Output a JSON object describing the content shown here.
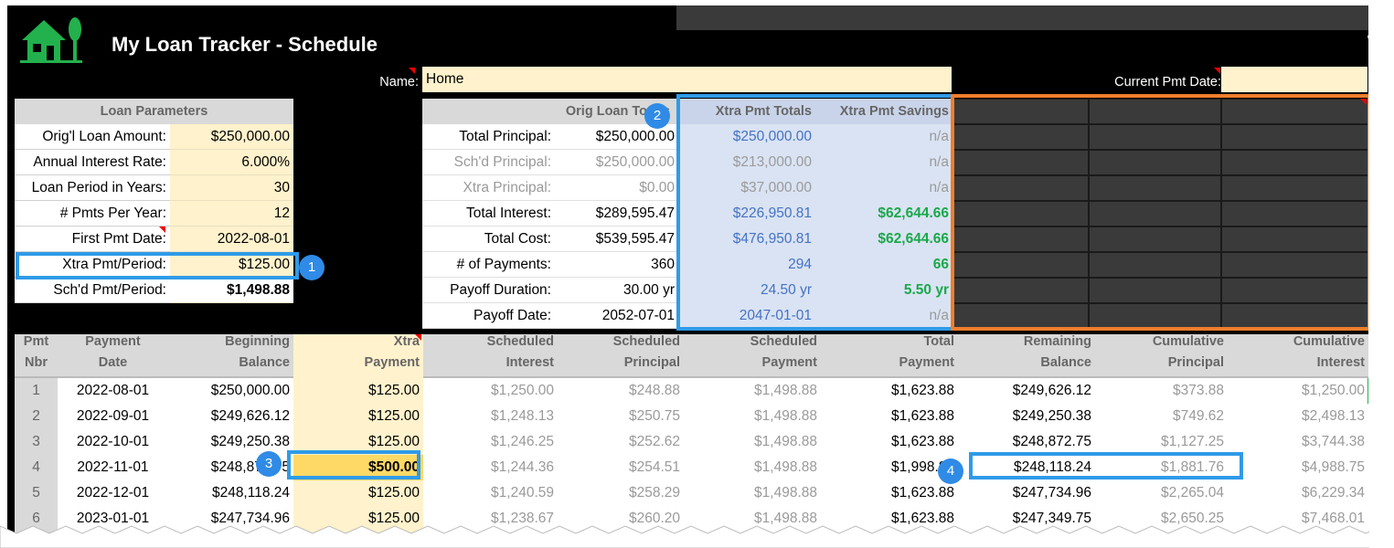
{
  "title": "My Loan Tracker - Schedule",
  "name_label": "Name:",
  "name_value": "Home",
  "current_pmt_label": "Current Pmt Date:",
  "current_pmt_value": "",
  "params": {
    "header": "Loan Parameters",
    "rows": [
      {
        "label": "Orig'l Loan Amount:",
        "value": "$250,000.00"
      },
      {
        "label": "Annual Interest Rate:",
        "value": "6.000%"
      },
      {
        "label": "Loan Period in Years:",
        "value": "30"
      },
      {
        "label": "# Pmts Per Year:",
        "value": "12"
      },
      {
        "label": "First Pmt Date:",
        "value": "2022-08-01"
      },
      {
        "label": "Xtra Pmt/Period:",
        "value": "$125.00"
      },
      {
        "label": "Sch'd Pmt/Period:",
        "value": "$1,498.88"
      }
    ]
  },
  "totals": {
    "headers": {
      "orig": "Orig Loan Totals",
      "xtra": "Xtra Pmt Totals",
      "savings": "Xtra Pmt Savings"
    },
    "rows": [
      {
        "label": "Total Principal:",
        "orig": "$250,000.00",
        "xtra": "$250,000.00",
        "savings": "n/a"
      },
      {
        "label": "Sch'd Principal:",
        "orig": "$250,000.00",
        "xtra": "$213,000.00",
        "savings": "n/a"
      },
      {
        "label": "Xtra Principal:",
        "orig": "$0.00",
        "xtra": "$37,000.00",
        "savings": "n/a"
      },
      {
        "label": "Total Interest:",
        "orig": "$289,595.47",
        "xtra": "$226,950.81",
        "savings": "$62,644.66"
      },
      {
        "label": "Total Cost:",
        "orig": "$539,595.47",
        "xtra": "$476,950.81",
        "savings": "$62,644.66"
      },
      {
        "label": "# of Payments:",
        "orig": "360",
        "xtra": "294",
        "savings": "66"
      },
      {
        "label": "Payoff Duration:",
        "orig": "30.00 yr",
        "xtra": "24.50 yr",
        "savings": "5.50 yr"
      },
      {
        "label": "Payoff Date:",
        "orig": "2052-07-01",
        "xtra": "2047-01-01",
        "savings": "n/a"
      }
    ]
  },
  "schedule": {
    "headers": [
      [
        "Pmt",
        "Nbr"
      ],
      [
        "Payment",
        "Date"
      ],
      [
        "Beginning",
        "Balance"
      ],
      [
        "Xtra",
        "Payment"
      ],
      [
        "Scheduled",
        "Interest"
      ],
      [
        "Scheduled",
        "Principal"
      ],
      [
        "Scheduled",
        "Payment"
      ],
      [
        "Total",
        "Payment"
      ],
      [
        "Remaining",
        "Balance"
      ],
      [
        "Cumulative",
        "Principal"
      ],
      [
        "Cumulative",
        "Interest"
      ]
    ],
    "rows": [
      [
        "1",
        "2022-08-01",
        "$250,000.00",
        "$125.00",
        "$1,250.00",
        "$248.88",
        "$1,498.88",
        "$1,623.88",
        "$249,626.12",
        "$373.88",
        "$1,250.00"
      ],
      [
        "2",
        "2022-09-01",
        "$249,626.12",
        "$125.00",
        "$1,248.13",
        "$250.75",
        "$1,498.88",
        "$1,623.88",
        "$249,250.38",
        "$749.62",
        "$2,498.13"
      ],
      [
        "3",
        "2022-10-01",
        "$249,250.38",
        "$125.00",
        "$1,246.25",
        "$252.62",
        "$1,498.88",
        "$1,623.88",
        "$248,872.75",
        "$1,127.25",
        "$3,744.38"
      ],
      [
        "4",
        "2022-11-01",
        "$248,872.75",
        "$500.00",
        "$1,244.36",
        "$254.51",
        "$1,498.88",
        "$1,998.88",
        "$248,118.24",
        "$1,881.76",
        "$4,988.75"
      ],
      [
        "5",
        "2022-12-01",
        "$248,118.24",
        "$125.00",
        "$1,240.59",
        "$258.29",
        "$1,498.88",
        "$1,623.88",
        "$247,734.96",
        "$2,265.04",
        "$6,229.34"
      ],
      [
        "6",
        "2023-01-01",
        "$247,734.96",
        "$125.00",
        "$1,238.67",
        "$260.20",
        "$1,498.88",
        "$1,623.88",
        "$247,349.75",
        "$2,650.25",
        "$7,468.01"
      ]
    ]
  },
  "badges": [
    "1",
    "2",
    "3",
    "4"
  ],
  "colors": {
    "accent_blue": "#2f9be8",
    "accent_orange": "#f07d2c",
    "input_fill": "#fff2cc",
    "savings_green": "#1aa84a",
    "xtra_blue": "#4472c4"
  }
}
